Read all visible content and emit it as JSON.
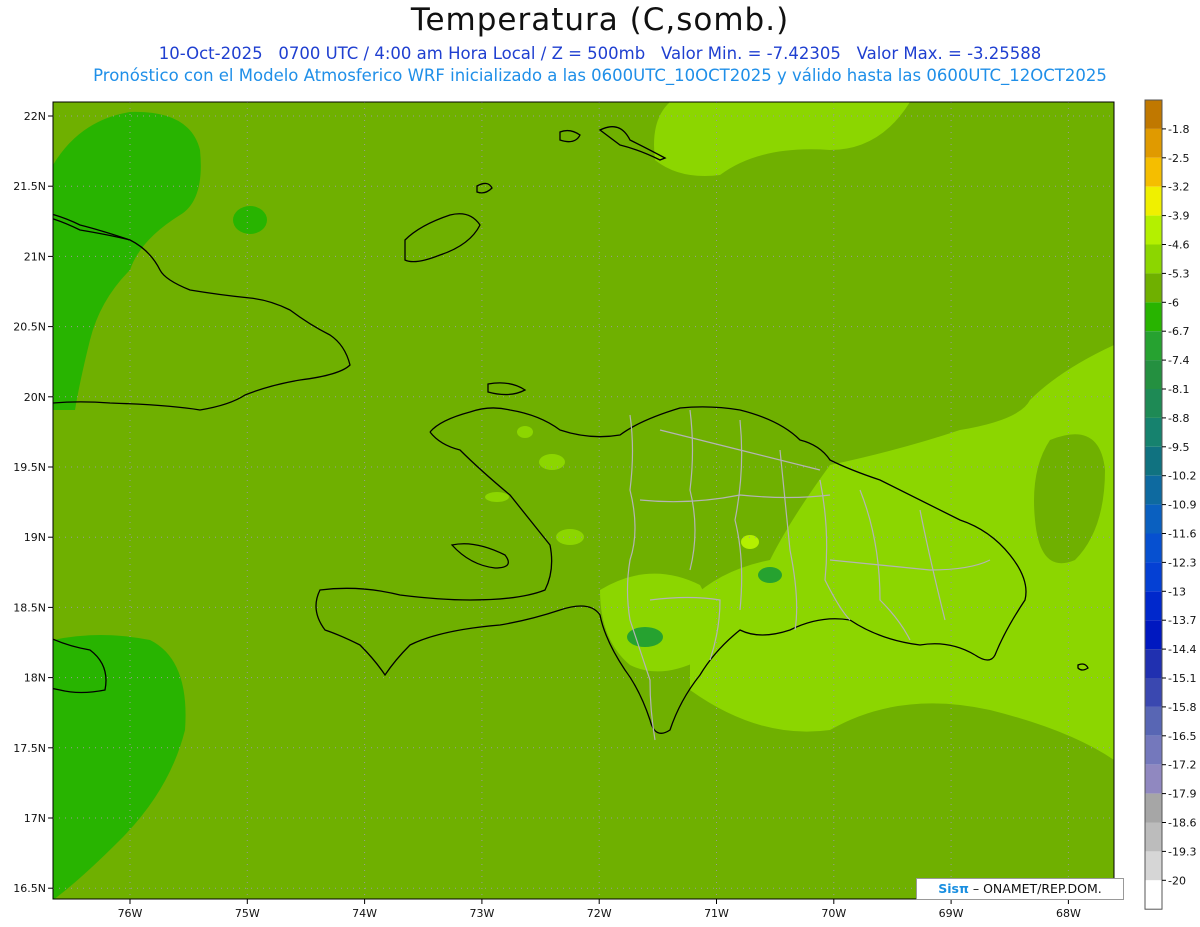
{
  "header": {
    "title": "Temperatura (C,somb.)",
    "date": "10-Oct-2025",
    "time_utc": "0700 UTC",
    "local_time": "4:00 am Hora Local",
    "level": "Z = 500mb",
    "min_label": "Valor Min. = -7.42305",
    "max_label": "Valor Max. = -3.25588",
    "model_line": "Pronóstico con el Modelo Atmosferico WRF inicializado a las 0600UTC_10OCT2025 y válido hasta las  0600UTC_12OCT2025"
  },
  "map": {
    "lat_labels": [
      "22N",
      "21.5N",
      "21N",
      "20.5N",
      "20N",
      "19.5N",
      "19N",
      "18.5N",
      "18N",
      "17.5N",
      "17N",
      "16.5N"
    ],
    "lon_labels": [
      "76W",
      "75W",
      "74W",
      "73W",
      "72W",
      "71W",
      "70W",
      "69W",
      "68W"
    ],
    "grid": "dotted",
    "background_color": "#6fb000",
    "regions": [
      "Cuba",
      "Hispaniola",
      "Bahamas",
      "Turks and Caicos",
      "Jamaica",
      "Puerto Rico"
    ]
  },
  "colorbar": {
    "levels": [
      "-1.8",
      "-2.5",
      "-3.2",
      "-3.9",
      "-4.6",
      "-5.3",
      "-6",
      "-6.7",
      "-7.4",
      "-8.1",
      "-8.8",
      "-9.5",
      "-10.2",
      "-10.9",
      "-11.6",
      "-12.3",
      "-13",
      "-13.7",
      "-14.4",
      "-15.1",
      "-15.8",
      "-16.5",
      "-17.2",
      "-17.9",
      "-18.6",
      "-19.3",
      "-20"
    ],
    "colors": [
      "#c07800",
      "#e09a00",
      "#f5be00",
      "#f0f000",
      "#b4f000",
      "#8cd600",
      "#6fb000",
      "#28b400",
      "#26a230",
      "#249040",
      "#1e8a55",
      "#16826e",
      "#107280",
      "#0e6aa0",
      "#0a60c0",
      "#0650d0",
      "#0440d4",
      "#0028cc",
      "#0018c0",
      "#2030b0",
      "#3a48b0",
      "#5866b4",
      "#7478bc",
      "#9088c0",
      "#a6a6a6",
      "#bcbcbc",
      "#d6d6d6",
      "#ffffff"
    ]
  },
  "footer": {
    "brand": "Sisπ",
    "org": "– ONAMET/REP.DOM."
  }
}
